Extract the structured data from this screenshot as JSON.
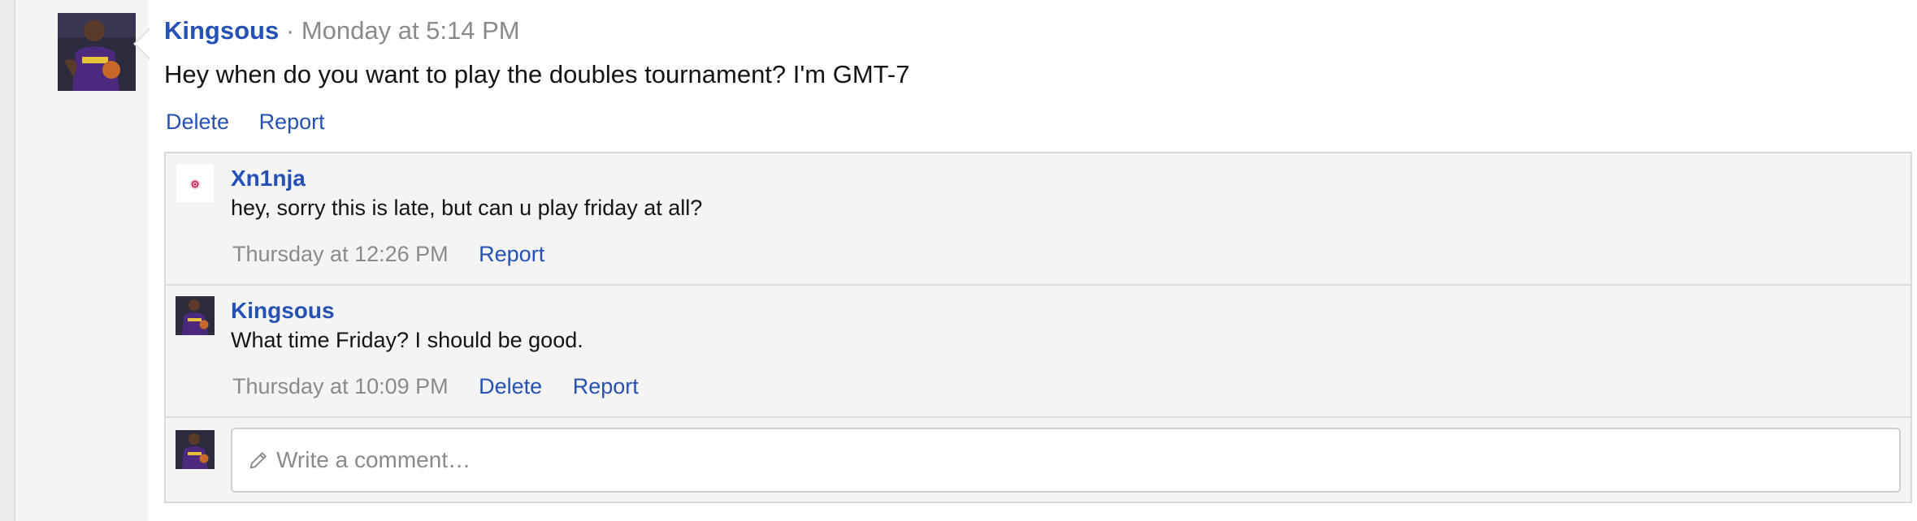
{
  "post": {
    "author": "Kingsous",
    "separator": "·",
    "time": "Monday at 5:14 PM",
    "message": "Hey when do you want to play the doubles tournament? I'm GMT-7",
    "actions": {
      "delete": "Delete",
      "report": "Report"
    }
  },
  "comments": [
    {
      "author": "Xn1nja",
      "text": "hey, sorry this is late, but can u play friday at all?",
      "time": "Thursday at 12:26 PM",
      "actions": {
        "report": "Report"
      }
    },
    {
      "author": "Kingsous",
      "text": "What time Friday? I should be good.",
      "time": "Thursday at 10:09 PM",
      "actions": {
        "delete": "Delete",
        "report": "Report"
      }
    }
  ],
  "composer": {
    "placeholder": "Write a comment…",
    "icon": "pencil-icon"
  },
  "colors": {
    "link": "#2451b3",
    "muted": "#8a8a8a",
    "panel": "#f4f4f4"
  }
}
